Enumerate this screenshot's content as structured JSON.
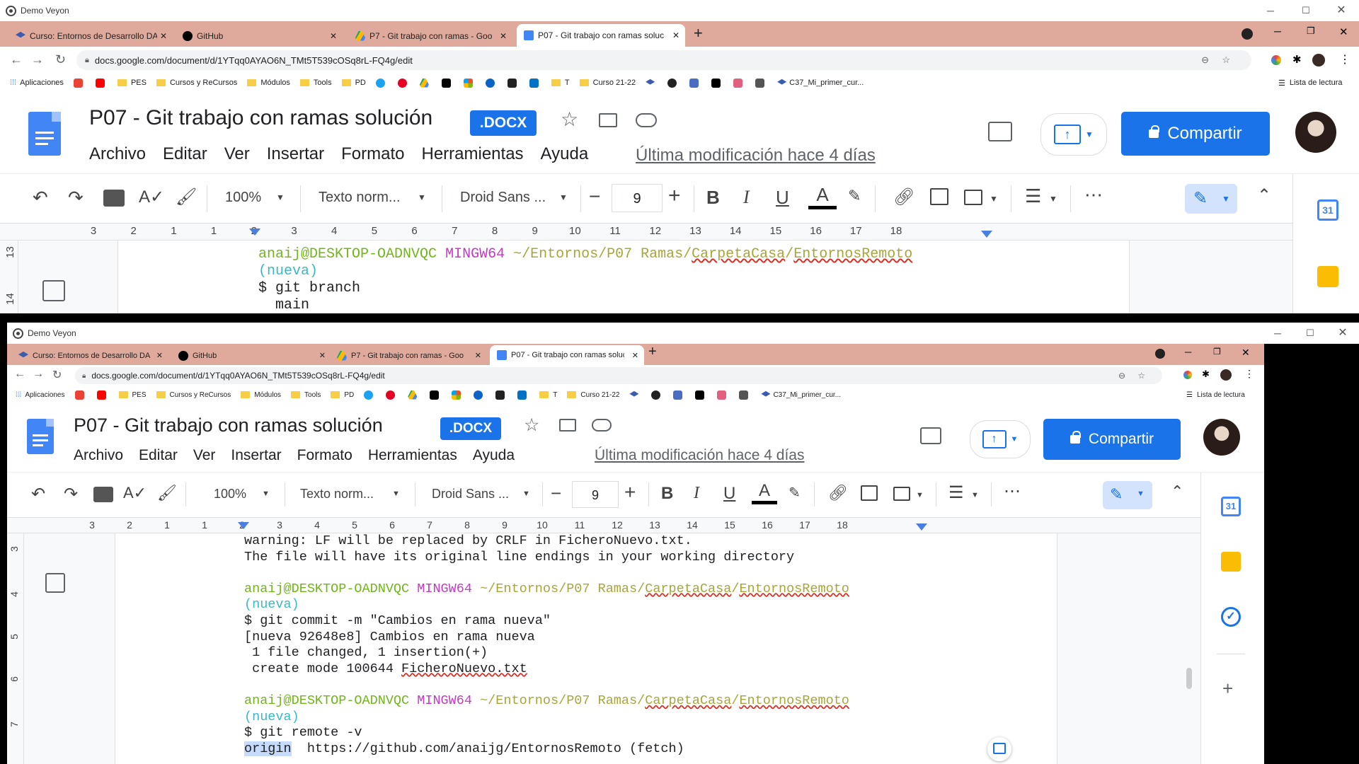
{
  "window_title": "Demo Veyon",
  "tabs": [
    {
      "label": "Curso: Entornos de Desarrollo DA",
      "icon": "moodle-cap-icon"
    },
    {
      "label": "GitHub",
      "icon": "github-icon"
    },
    {
      "label": "P7 - Git trabajo con ramas - Goo",
      "icon": "google-drive-icon"
    },
    {
      "label": "P07 - Git trabajo con ramas soluc",
      "icon": "google-docs-icon",
      "active": true
    }
  ],
  "url": "docs.google.com/document/d/1YTqq0AYAO6N_TMt5T539cOSq8rL-FQ4g/edit",
  "bookmarks": [
    "Aplicaciones",
    "PES",
    "Cursos y ReCursos",
    "Módulos",
    "Tools",
    "PD",
    "T",
    "Curso 21-22",
    "C37_Mi_primer_cur...",
    "Lista de lectura"
  ],
  "doc": {
    "title": "P07 - Git trabajo con ramas solución",
    "badge": ".DOCX",
    "menu": [
      "Archivo",
      "Editar",
      "Ver",
      "Insertar",
      "Formato",
      "Herramientas",
      "Ayuda"
    ],
    "last_modified": "Última modificación hace 4 días",
    "share": "Compartir"
  },
  "toolbar": {
    "zoom": "100%",
    "style": "Texto norm...",
    "font": "Droid Sans ...",
    "font_size": "9"
  },
  "ruler_top": [
    "3",
    "2",
    "1",
    "1",
    "2",
    "3",
    "4",
    "5",
    "6",
    "7",
    "8",
    "9",
    "10",
    "11",
    "12",
    "13",
    "14",
    "15",
    "16",
    "17",
    "18"
  ],
  "window1": {
    "vruler": [
      "13",
      "14"
    ],
    "code": {
      "prompt_user": "anaij@DESKTOP-OADNVQC",
      "prompt_env": "MINGW64",
      "prompt_path_a": "~/Entornos/P07 Ramas/",
      "prompt_path_b": "CarpetaCasa",
      "prompt_path_c": "/",
      "prompt_path_d": "EntornosRemoto",
      "branch": "(nueva)",
      "cmd": "$ git branch",
      "out": "  main"
    }
  },
  "window2": {
    "vruler": [
      "3",
      "4",
      "5",
      "6",
      "7"
    ],
    "code": {
      "l1": "warning: LF will be replaced by CRLF in FicheroNuevo.txt.",
      "l2": "The file will have its original line endings in your working directory",
      "prompt_user": "anaij@DESKTOP-OADNVQC",
      "prompt_env": "MINGW64",
      "prompt_path_a": "~/Entornos/P07 Ramas/",
      "prompt_path_b": "CarpetaCasa",
      "prompt_path_c": "/",
      "prompt_path_d": "EntornosRemoto",
      "branch": "(nueva)",
      "cmd1": "$ git commit -m \"Cambios en rama nueva\"",
      "o1": "[nueva 92648e8] Cambios en rama nueva",
      "o2": " 1 file changed, 1 insertion(+)",
      "o3a": " create mode 100644 ",
      "o3b": "FicheroNuevo.txt",
      "cmd2": "$ git remote -v",
      "o4a": "origin",
      "o4b": "  https://github.com/anaijg/EntornosRemoto (fetch)"
    }
  },
  "colors": {
    "tabbar": "#dfa99b",
    "accent": "#1a73e8",
    "prompt_green": "#72b51b",
    "prompt_magenta": "#c33bc3",
    "prompt_yellow": "#a6a63a",
    "prompt_cyan": "#3bb8c8"
  }
}
